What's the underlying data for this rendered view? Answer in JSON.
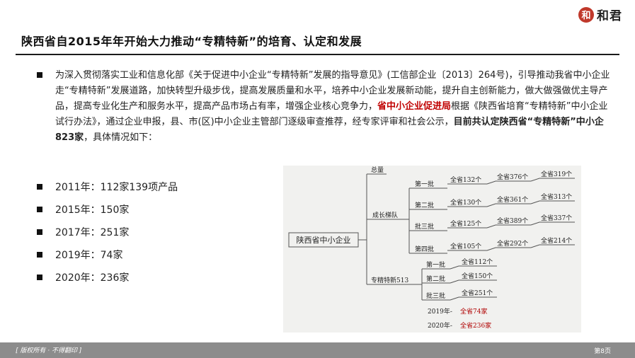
{
  "logo": {
    "mark": "和",
    "text": "和君"
  },
  "title": "陕西省自2015年年开始大力推动“专精特新”的培育、认定和发展",
  "paragraph": {
    "part1": "为深入贯彻落实工业和信息化部《关于促进中小企业“专精特新”发展的指导意见》(工信部企业〔2013〕264号)，引导推动我省中小企业走“专精特新”发展道路，加快转型升级步伐，提高发展质量和水平，培养中小企业发展新动能，提升自主创新能力，做大做强做优主导产品，提高专业化生产和服务水平，提高产品市场占有率，增强企业核心竞争力，",
    "red": "省中小企业促进局",
    "part2": "根据《陕西省培育“专精特新”中小企业试行办法》，通过企业申报，县、市(区)中小企业主管部门逐级审查推荐，经专家评审和社会公示，",
    "bold": "目前共认定陕西省“专精特新”中小企823家",
    "part3": "，具体情况如下："
  },
  "years": [
    {
      "label": "2011年：112家139项产品"
    },
    {
      "label": "2015年：150家"
    },
    {
      "label": "2017年：251家"
    },
    {
      "label": "2019年：74家"
    },
    {
      "label": "2020年：236家"
    }
  ],
  "diagram": {
    "root": "陕西省中小企业",
    "total": "总量",
    "growth": "成长梯队",
    "special": "专精特新513",
    "growth_batches": [
      {
        "name": "第一批",
        "a": "全省132个",
        "b": "全省376个",
        "c": "全省319个"
      },
      {
        "name": "第二批",
        "a": "全省130个",
        "b": "全省361个",
        "c": "全省313个"
      },
      {
        "name": "批三批",
        "a": "全省125个",
        "b": "全省389个",
        "c": "全省337个"
      },
      {
        "name": "第四批",
        "a": "全省105个",
        "b": "全省292个",
        "c": "全省214个"
      }
    ],
    "special_batches": [
      {
        "name": "第一批",
        "value": "全省112个"
      },
      {
        "name": "第二批",
        "value": "全省150个"
      },
      {
        "name": "批三批",
        "value": "全省251个"
      }
    ],
    "y2019": {
      "year": "2019年-",
      "value": "全省74家"
    },
    "y2020": {
      "year": "2020年-",
      "value": "全省236家"
    }
  },
  "footer": {
    "left": "[ 版权所有 · 不得翻印 ]",
    "page": "第8页"
  }
}
